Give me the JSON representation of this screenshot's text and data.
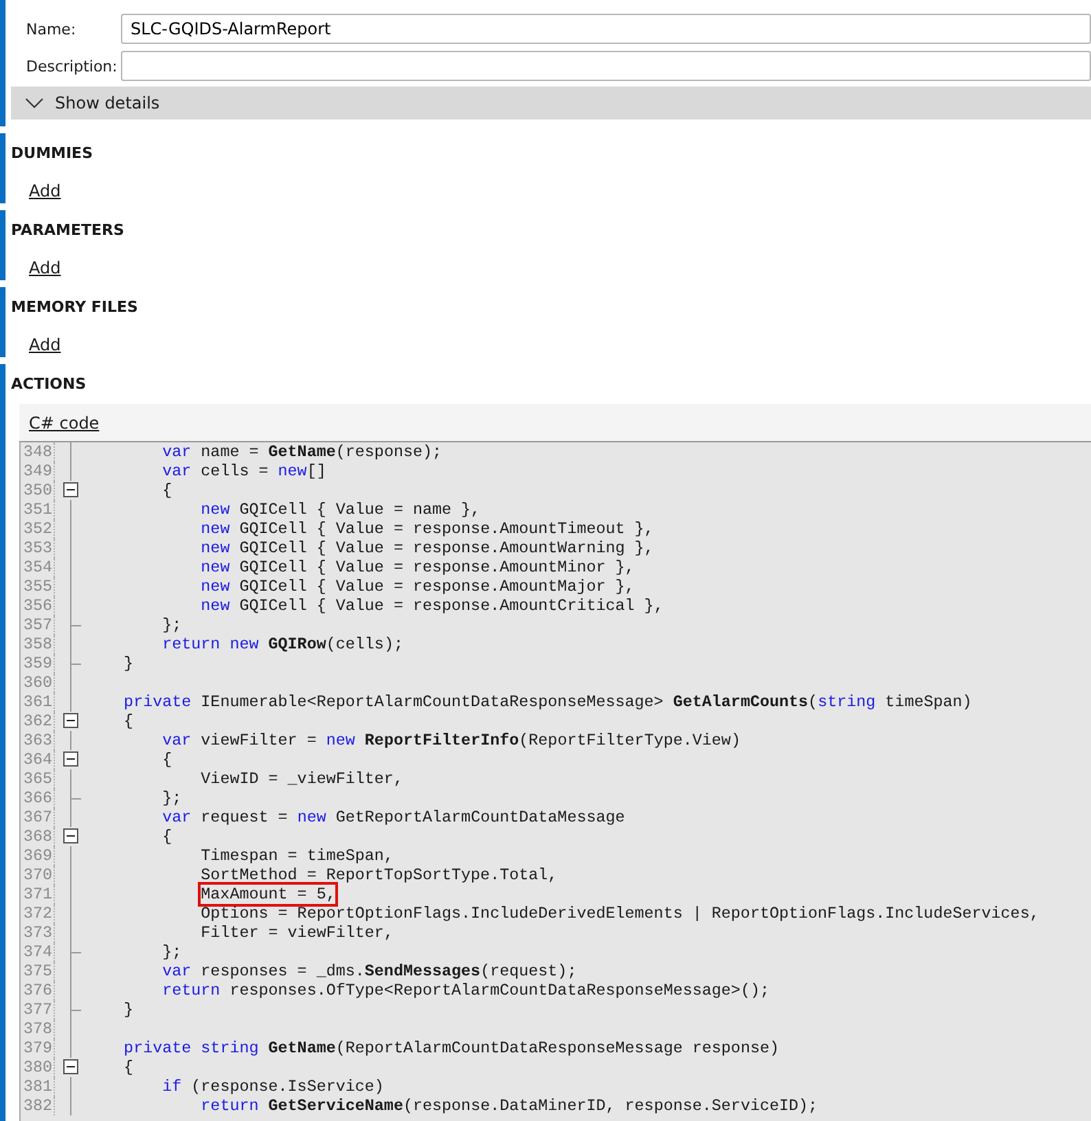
{
  "general": {
    "fields": [
      {
        "label": "Name:",
        "value": "SLC-GQIDS-AlarmReport"
      },
      {
        "label": "Description:"
      }
    ],
    "details_toggle": {
      "label": "Show details",
      "expanded": false
    }
  },
  "sections": [
    {
      "title": "DUMMIES",
      "link": "Add"
    },
    {
      "title": "PARAMETERS",
      "link": "Add"
    },
    {
      "title": "MEMORY FILES",
      "link": "Add"
    }
  ],
  "actions": {
    "title": "ACTIONS",
    "tab": "C# code",
    "code_lines": [
      {
        "number": "348",
        "fold_open": false,
        "fold_end": false,
        "tokens": [
          {
            "kind": "keyword",
            "text": "        var"
          },
          {
            "kind": "plain",
            "text": " name = "
          },
          {
            "kind": "method",
            "text": "GetName"
          },
          {
            "kind": "plain",
            "text": "(response);"
          }
        ]
      },
      {
        "number": "349",
        "fold_open": false,
        "fold_end": false,
        "tokens": [
          {
            "kind": "keyword",
            "text": "        var"
          },
          {
            "kind": "plain",
            "text": " cells = "
          },
          {
            "kind": "keyword",
            "text": "new"
          },
          {
            "kind": "plain",
            "text": "[]"
          }
        ]
      },
      {
        "number": "350",
        "fold_open": true,
        "fold_end": false,
        "tokens": [
          {
            "kind": "plain",
            "text": "        {"
          }
        ]
      },
      {
        "number": "351",
        "fold_open": false,
        "fold_end": false,
        "tokens": [
          {
            "kind": "keyword",
            "text": "            new"
          },
          {
            "kind": "plain",
            "text": " GQICell { Value = name },"
          }
        ]
      },
      {
        "number": "352",
        "fold_open": false,
        "fold_end": false,
        "tokens": [
          {
            "kind": "keyword",
            "text": "            new"
          },
          {
            "kind": "plain",
            "text": " GQICell { Value = response.AmountTimeout },"
          }
        ]
      },
      {
        "number": "353",
        "fold_open": false,
        "fold_end": false,
        "tokens": [
          {
            "kind": "keyword",
            "text": "            new"
          },
          {
            "kind": "plain",
            "text": " GQICell { Value = response.AmountWarning },"
          }
        ]
      },
      {
        "number": "354",
        "fold_open": false,
        "fold_end": false,
        "tokens": [
          {
            "kind": "keyword",
            "text": "            new"
          },
          {
            "kind": "plain",
            "text": " GQICell { Value = response.AmountMinor },"
          }
        ]
      },
      {
        "number": "355",
        "fold_open": false,
        "fold_end": false,
        "tokens": [
          {
            "kind": "keyword",
            "text": "            new"
          },
          {
            "kind": "plain",
            "text": " GQICell { Value = response.AmountMajor },"
          }
        ]
      },
      {
        "number": "356",
        "fold_open": false,
        "fold_end": false,
        "tokens": [
          {
            "kind": "keyword",
            "text": "            new"
          },
          {
            "kind": "plain",
            "text": " GQICell { Value = response.AmountCritical },"
          }
        ]
      },
      {
        "number": "357",
        "fold_open": false,
        "fold_end": true,
        "tokens": [
          {
            "kind": "plain",
            "text": "        };"
          }
        ]
      },
      {
        "number": "358",
        "fold_open": false,
        "fold_end": false,
        "tokens": [
          {
            "kind": "keyword",
            "text": "        return new "
          },
          {
            "kind": "method",
            "text": "GQIRow"
          },
          {
            "kind": "plain",
            "text": "(cells);"
          }
        ]
      },
      {
        "number": "359",
        "fold_open": false,
        "fold_end": true,
        "tokens": [
          {
            "kind": "plain",
            "text": "    }"
          }
        ]
      },
      {
        "number": "360",
        "fold_open": false,
        "fold_end": false
      },
      {
        "number": "361",
        "fold_open": false,
        "fold_end": false,
        "tokens": [
          {
            "kind": "keyword",
            "text": "    private"
          },
          {
            "kind": "plain",
            "text": " IEnumerable<ReportAlarmCountDataResponseMessage> "
          },
          {
            "kind": "method",
            "text": "GetAlarmCounts"
          },
          {
            "kind": "plain",
            "text": "("
          },
          {
            "kind": "keyword",
            "text": "string"
          },
          {
            "kind": "plain",
            "text": " timeSpan)"
          }
        ]
      },
      {
        "number": "362",
        "fold_open": true,
        "fold_end": false,
        "tokens": [
          {
            "kind": "plain",
            "text": "    {"
          }
        ]
      },
      {
        "number": "363",
        "fold_open": false,
        "fold_end": false,
        "tokens": [
          {
            "kind": "keyword",
            "text": "        var"
          },
          {
            "kind": "plain",
            "text": " viewFilter = "
          },
          {
            "kind": "keyword",
            "text": "new "
          },
          {
            "kind": "method",
            "text": "ReportFilterInfo"
          },
          {
            "kind": "plain",
            "text": "(ReportFilterType.View)"
          }
        ]
      },
      {
        "number": "364",
        "fold_open": true,
        "fold_end": false,
        "tokens": [
          {
            "kind": "plain",
            "text": "        {"
          }
        ]
      },
      {
        "number": "365",
        "fold_open": false,
        "fold_end": false,
        "tokens": [
          {
            "kind": "plain",
            "text": "            ViewID = _viewFilter,"
          }
        ]
      },
      {
        "number": "366",
        "fold_open": false,
        "fold_end": true,
        "tokens": [
          {
            "kind": "plain",
            "text": "        };"
          }
        ]
      },
      {
        "number": "367",
        "fold_open": false,
        "fold_end": false,
        "tokens": [
          {
            "kind": "keyword",
            "text": "        var"
          },
          {
            "kind": "plain",
            "text": " request = "
          },
          {
            "kind": "keyword",
            "text": "new"
          },
          {
            "kind": "plain",
            "text": " GetReportAlarmCountDataMessage"
          }
        ]
      },
      {
        "number": "368",
        "fold_open": true,
        "fold_end": false,
        "tokens": [
          {
            "kind": "plain",
            "text": "        {"
          }
        ]
      },
      {
        "number": "369",
        "fold_open": false,
        "fold_end": false,
        "tokens": [
          {
            "kind": "plain",
            "text": "            Timespan = timeSpan,"
          }
        ]
      },
      {
        "number": "370",
        "fold_open": false,
        "fold_end": false,
        "tokens": [
          {
            "kind": "plain",
            "text": "            SortMethod = ReportTopSortType.Total,"
          }
        ]
      },
      {
        "number": "371",
        "fold_open": false,
        "fold_end": false,
        "tokens": [
          {
            "kind": "boxed",
            "text": "MaxAmount = 5,"
          }
        ]
      },
      {
        "number": "372",
        "fold_open": false,
        "fold_end": false,
        "tokens": [
          {
            "kind": "plain",
            "text": "            Options = ReportOptionFlags.IncludeDerivedElements | ReportOptionFlags.IncludeServices,"
          }
        ]
      },
      {
        "number": "373",
        "fold_open": false,
        "fold_end": false,
        "tokens": [
          {
            "kind": "plain",
            "text": "            Filter = viewFilter,"
          }
        ]
      },
      {
        "number": "374",
        "fold_open": false,
        "fold_end": true,
        "tokens": [
          {
            "kind": "plain",
            "text": "        };"
          }
        ]
      },
      {
        "number": "375",
        "fold_open": false,
        "fold_end": false,
        "tokens": [
          {
            "kind": "keyword",
            "text": "        var"
          },
          {
            "kind": "plain",
            "text": " responses = _dms."
          },
          {
            "kind": "method",
            "text": "SendMessages"
          },
          {
            "kind": "plain",
            "text": "(request);"
          }
        ]
      },
      {
        "number": "376",
        "fold_open": false,
        "fold_end": false,
        "tokens": [
          {
            "kind": "keyword",
            "text": "        return"
          },
          {
            "kind": "plain",
            "text": " responses.OfType<ReportAlarmCountDataResponseMessage>();"
          }
        ]
      },
      {
        "number": "377",
        "fold_open": false,
        "fold_end": true,
        "tokens": [
          {
            "kind": "plain",
            "text": "    }"
          }
        ]
      },
      {
        "number": "378",
        "fold_open": false,
        "fold_end": false
      },
      {
        "number": "379",
        "fold_open": false,
        "fold_end": false,
        "tokens": [
          {
            "kind": "keyword",
            "text": "    private string "
          },
          {
            "kind": "method",
            "text": "GetName"
          },
          {
            "kind": "plain",
            "text": "(ReportAlarmCountDataResponseMessage response)"
          }
        ]
      },
      {
        "number": "380",
        "fold_open": true,
        "fold_end": false,
        "tokens": [
          {
            "kind": "plain",
            "text": "    {"
          }
        ]
      },
      {
        "number": "381",
        "fold_open": false,
        "fold_end": false,
        "tokens": [
          {
            "kind": "keyword",
            "text": "        if"
          },
          {
            "kind": "plain",
            "text": " (response.IsService)"
          }
        ]
      },
      {
        "number": "382",
        "fold_open": false,
        "fold_end": false,
        "tokens": [
          {
            "kind": "keyword",
            "text": "            return "
          },
          {
            "kind": "method",
            "text": "GetServiceName"
          },
          {
            "kind": "plain",
            "text": "(response.DataMinerID, response.ServiceID);"
          }
        ]
      }
    ]
  }
}
